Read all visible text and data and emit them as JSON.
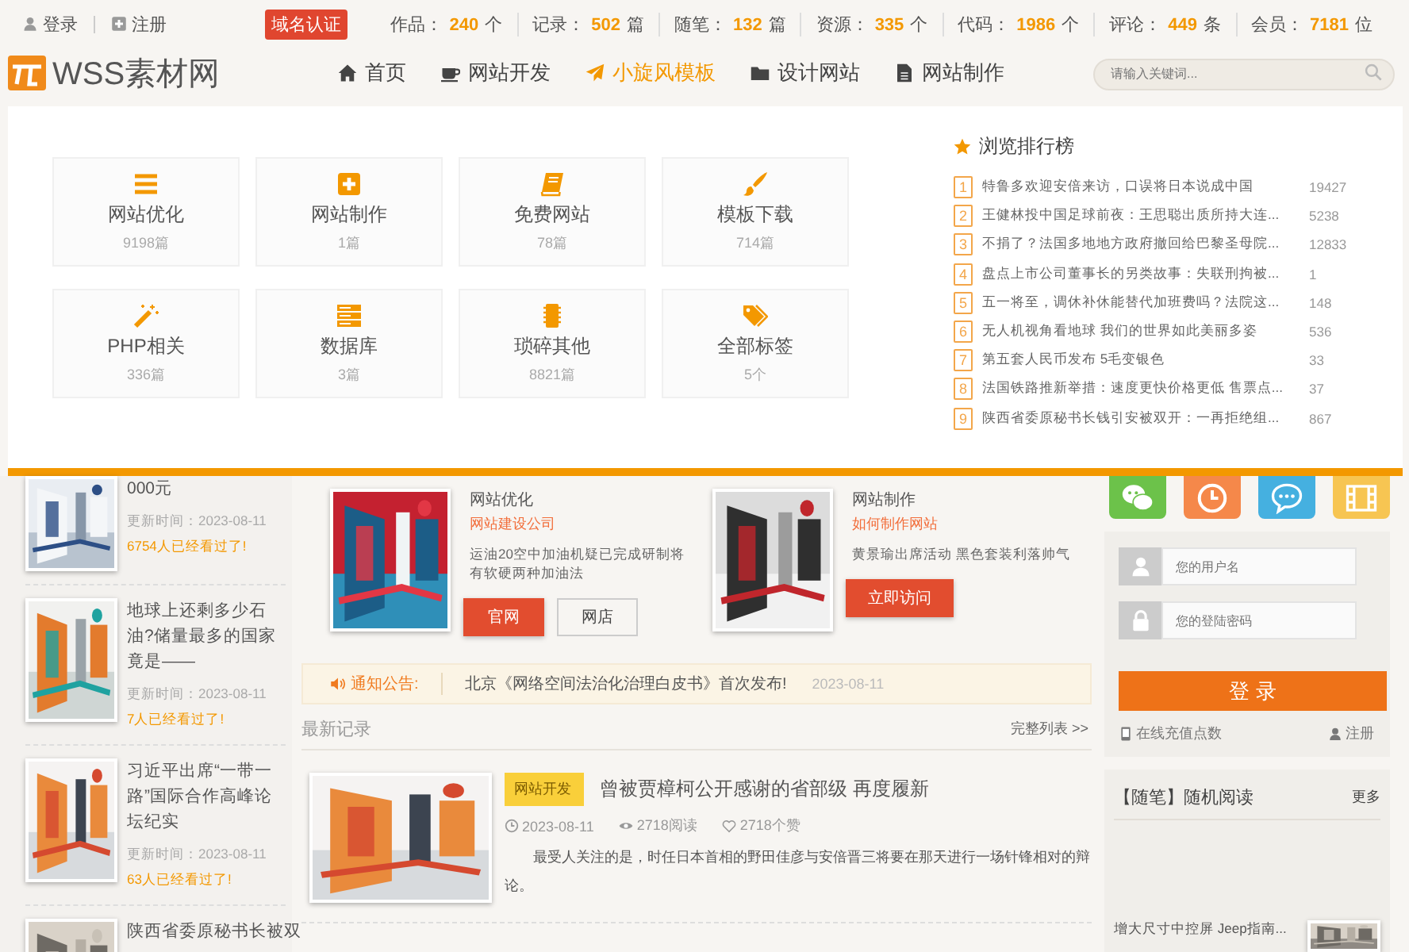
{
  "top_bar": {
    "links": [
      {
        "label": "登录",
        "kind": "user"
      },
      {
        "label": "注册",
        "kind": "plus"
      }
    ],
    "badge": "域名认证",
    "stats": [
      {
        "label": "作品：",
        "value": "240",
        "unit": "个"
      },
      {
        "label": "记录：",
        "value": "502",
        "unit": "篇"
      },
      {
        "label": "随笔：",
        "value": "132",
        "unit": "篇"
      },
      {
        "label": "资源：",
        "value": "335",
        "unit": "个"
      },
      {
        "label": "代码：",
        "value": "1986",
        "unit": "个"
      },
      {
        "label": "评论：",
        "value": "449",
        "unit": "条"
      },
      {
        "label": "会员：",
        "value": "7181",
        "unit": "位"
      }
    ]
  },
  "header": {
    "logo": "WSS素材网",
    "nav": [
      {
        "label": "首页",
        "kind": "home",
        "selected": false
      },
      {
        "label": "网站开发",
        "kind": "cup",
        "selected": false
      },
      {
        "label": "小旋风模板",
        "kind": "plane",
        "selected": true
      },
      {
        "label": "设计网站",
        "kind": "folder",
        "selected": false
      },
      {
        "label": "网站制作",
        "kind": "file",
        "selected": false
      }
    ],
    "search": {
      "placeholder": "请输入关键词..."
    }
  },
  "dropdown": {
    "categories": [
      {
        "name": "网站优化",
        "count": "9198篇",
        "kind": "list"
      },
      {
        "name": "网站制作",
        "count": "1篇",
        "kind": "plus"
      },
      {
        "name": "免费网站",
        "count": "78篇",
        "kind": "book"
      },
      {
        "name": "模板下载",
        "count": "714篇",
        "kind": "brush"
      },
      {
        "name": "PHP相关",
        "count": "336篇",
        "kind": "wand"
      },
      {
        "name": "数据库",
        "count": "3篇",
        "kind": "server"
      },
      {
        "name": "琐碎其他",
        "count": "8821篇",
        "kind": "chip"
      },
      {
        "name": "全部标签",
        "count": "5个",
        "kind": "tags"
      }
    ],
    "ranking": {
      "title": "浏览排行榜",
      "items": [
        {
          "rank": "1",
          "title": "特鲁多欢迎安倍来访，口误将日本说成中国",
          "views": "19427"
        },
        {
          "rank": "2",
          "title": "王健林投中国足球前夜：王思聪出质所持大连...",
          "views": "5238"
        },
        {
          "rank": "3",
          "title": "不捐了？法国多地地方政府撤回给巴黎圣母院...",
          "views": "12833"
        },
        {
          "rank": "4",
          "title": "盘点上市公司董事长的另类故事：失联刑拘被...",
          "views": "1"
        },
        {
          "rank": "5",
          "title": "五一将至，调休补休能替代加班费吗？法院这...",
          "views": "148"
        },
        {
          "rank": "6",
          "title": "无人机视角看地球 我们的世界如此美丽多姿",
          "views": "536"
        },
        {
          "rank": "7",
          "title": "第五套人民币发布 5毛变银色",
          "views": "33"
        },
        {
          "rank": "8",
          "title": "法国铁路推新举措：速度更快价格更低 售票点...",
          "views": "37"
        },
        {
          "rank": "9",
          "title": "陕西省委原秘书长钱引安被双开：一再拒绝组...",
          "views": "867"
        }
      ]
    }
  },
  "left_posts": [
    {
      "title": "000元",
      "updated": "更新时间：2023-08-11",
      "views": "6754人已经看过了!"
    },
    {
      "title": "地球上还剩多少石油?储量最多的国家竟是——",
      "updated": "更新时间：2023-08-11",
      "views": "7人已经看过了!"
    },
    {
      "title": "习近平出席“一带一路”国际合作高峰论坛纪实",
      "updated": "更新时间：2023-08-11",
      "views": "63人已经看过了!"
    },
    {
      "title": "陕西省委原秘书长被双"
    }
  ],
  "promos": [
    {
      "category": "网站优化",
      "subtitle": "网站建设公司",
      "description": "运油20空中加油机疑已完成研制将有软硬两种加油法",
      "buttons": [
        {
          "label": "官网",
          "kind": "primary"
        },
        {
          "label": "网店",
          "kind": "outline"
        }
      ]
    },
    {
      "category": "网站制作",
      "subtitle": "如何制作网站",
      "description": "黄景瑜出席活动 黑色套装利落帅气",
      "buttons": [
        {
          "label": "立即访问",
          "kind": "primary"
        }
      ]
    }
  ],
  "notice": {
    "label": "通知公告:",
    "text": "北京《网络空间法治化治理白皮书》首次发布!",
    "date": "2023-08-11"
  },
  "latest": {
    "title": "最新记录",
    "more": "完整列表 >>",
    "articles": [
      {
        "tag": "网站开发",
        "title": "曾被贾樟柯公开感谢的省部级 再度履新",
        "date": "2023-08-11",
        "reads": "2718阅读",
        "likes": "2718个赞",
        "excerpt": "最受人关注的是，时任日本首相的野田佳彦与安倍晋三将要在那天进行一场针锋相对的辩论。"
      }
    ]
  },
  "right": {
    "social": [
      {
        "kind": "chat",
        "color": "#6cc24a"
      },
      {
        "kind": "clock",
        "color": "#f5884a"
      },
      {
        "kind": "message",
        "color": "#45b0e0"
      },
      {
        "kind": "film",
        "color": "#f7c552"
      }
    ],
    "login": {
      "username": {
        "placeholder": "您的用户名"
      },
      "password": {
        "placeholder": "您的登陆密码"
      },
      "button": "登 录",
      "recharge": "在线充值点数",
      "register": "注册"
    },
    "random": {
      "title": "【随笔】随机阅读",
      "more": "更多",
      "items": [
        {
          "title": "增大尺寸中控屏 Jeep指南..."
        }
      ]
    }
  }
}
